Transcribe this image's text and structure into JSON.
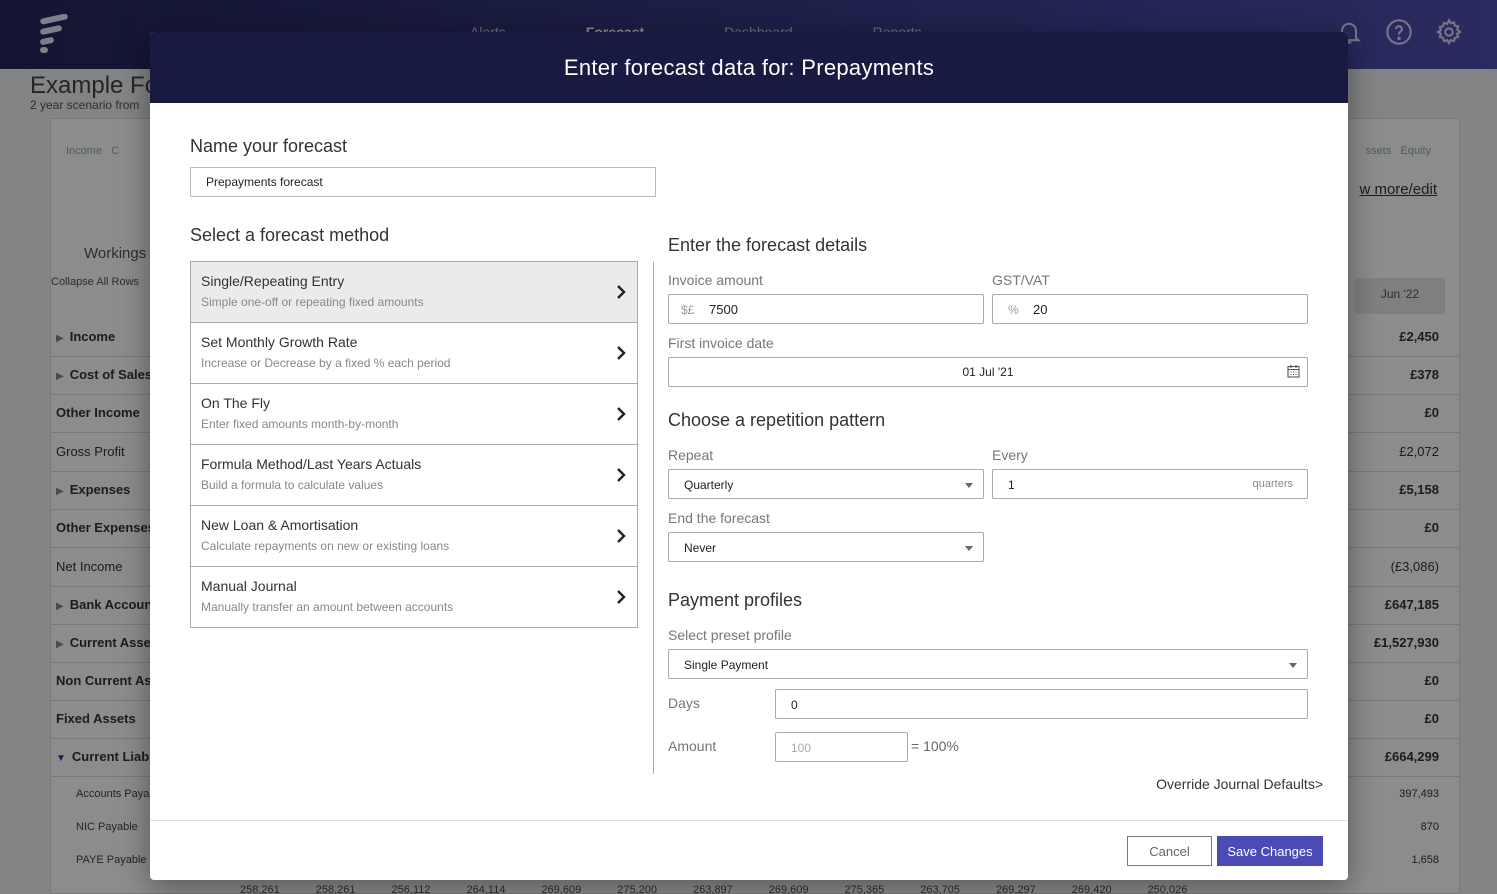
{
  "app": {
    "nav": [
      "Alerts",
      "Forecast",
      "Dashboard",
      "Reports"
    ],
    "active_nav": "Forecast",
    "page_title": "Example Fo",
    "page_subtitle": "2 year scenario from",
    "legend_left": [
      "Income",
      "C"
    ],
    "legend_right": [
      "ssets",
      "Equity"
    ],
    "show_more": "w more/edit",
    "workings": "Workings",
    "collapse_all": "Collapse All Rows",
    "month_header": "Jun '22",
    "rows": [
      {
        "label": "Income",
        "value": "£2,450"
      },
      {
        "label": "Cost of Sales",
        "value": "£378"
      },
      {
        "label": "Other Income",
        "value": "£0"
      },
      {
        "label": "Gross Profit",
        "value": "£2,072"
      },
      {
        "label": "Expenses",
        "value": "£5,158"
      },
      {
        "label": "Other Expenses",
        "value": "£0"
      },
      {
        "label": "Net Income",
        "value": "(£3,086)"
      },
      {
        "label": "Bank Accoun",
        "value": "£647,185"
      },
      {
        "label": "Current Asse",
        "value": "£1,527,930"
      },
      {
        "label": "Non Current Ass",
        "value": "£0"
      },
      {
        "label": "Fixed Assets",
        "value": "£0"
      },
      {
        "label": "Current Liabil",
        "value": "£664,299"
      },
      {
        "label": "Accounts Paya",
        "value": "397,493"
      },
      {
        "label": "NIC Payable",
        "value": "870"
      },
      {
        "label": "PAYE Payable",
        "value": "1,658"
      }
    ],
    "bottom_values": [
      "258,261",
      "258,261",
      "256,112",
      "264,114",
      "269,609",
      "275,200",
      "263,897",
      "269,609",
      "275,365",
      "263,705",
      "269,297",
      "269,420",
      "250,026"
    ]
  },
  "modal": {
    "title": "Enter forecast data for: Prepayments",
    "name_heading": "Name your forecast",
    "name_value": "Prepayments forecast",
    "method_heading": "Select a forecast method",
    "methods": [
      {
        "title": "Single/Repeating Entry",
        "desc": "Simple one-off or repeating fixed amounts"
      },
      {
        "title": "Set Monthly Growth Rate",
        "desc": "Increase or Decrease by a fixed % each period"
      },
      {
        "title": "On The Fly",
        "desc": "Enter fixed amounts month-by-month"
      },
      {
        "title": "Formula Method/Last Years Actuals",
        "desc": "Build a formula to calculate values"
      },
      {
        "title": "New Loan & Amortisation",
        "desc": "Calculate repayments on new or existing loans"
      },
      {
        "title": "Manual Journal",
        "desc": "Manually transfer an amount between accounts"
      }
    ],
    "details_heading": "Enter the forecast details",
    "invoice_label": "Invoice amount",
    "invoice_prefix": "$£",
    "invoice_value": "7500",
    "gst_label": "GST/VAT",
    "gst_prefix": "%",
    "gst_value": "20",
    "first_date_label": "First invoice date",
    "first_date_value": "01 Jul '21",
    "repetition_heading": "Choose a repetition pattern",
    "repeat_label": "Repeat",
    "repeat_value": "Quarterly",
    "every_label": "Every",
    "every_value": "1",
    "every_suffix": "quarters",
    "end_label": "End the forecast",
    "end_value": "Never",
    "payment_heading": "Payment profiles",
    "preset_label": "Select preset profile",
    "preset_value": "Single Payment",
    "days_label": "Days",
    "days_value": "0",
    "amount_label": "Amount",
    "amount_placeholder": "100",
    "amount_pct": "= 100%",
    "override_link": "Override Journal Defaults>",
    "cancel_label": "Cancel",
    "save_label": "Save Changes"
  }
}
